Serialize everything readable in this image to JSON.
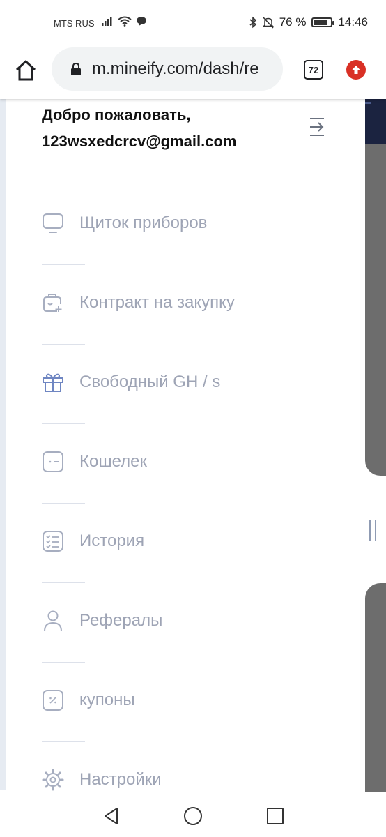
{
  "status_bar": {
    "carrier": "MTS RUS",
    "battery_percent": "76 %",
    "battery_level": 0.76,
    "time": "14:46",
    "icons": [
      "signal-icon",
      "wifi-icon",
      "message-icon",
      "bluetooth-icon",
      "mute-icon",
      "battery-icon"
    ]
  },
  "browser": {
    "url": "m.mineify.com/dash/re",
    "tabs_count": "72",
    "icons": [
      "home-icon",
      "lock-icon",
      "tabs-icon",
      "update-icon"
    ]
  },
  "drawer": {
    "welcome_line1": "Добро пожаловать,",
    "welcome_line2": "123wsxedcrcv@gmail.com",
    "collapse_icon": "collapse-icon",
    "items": [
      {
        "label": "Щиток приборов",
        "icon": "monitor-icon",
        "active": false
      },
      {
        "label": "Контракт на закупку",
        "icon": "contract-icon",
        "active": false
      },
      {
        "label": "Свободный GH / s",
        "icon": "gift-icon",
        "active": true
      },
      {
        "label": "Кошелек",
        "icon": "wallet-icon",
        "active": false
      },
      {
        "label": "История",
        "icon": "history-icon",
        "active": false
      },
      {
        "label": "Рефералы",
        "icon": "user-icon",
        "active": false
      },
      {
        "label": "купоны",
        "icon": "coupon-icon",
        "active": false
      },
      {
        "label": "Настройки",
        "icon": "settings-icon",
        "active": false
      }
    ]
  },
  "colors": {
    "menu_text": "#9ea4b5",
    "menu_icon": "#a7aec0",
    "active_icon": "#6f86c2",
    "dark_header": "#1b2340",
    "overlay_gray": "#6d6d6d"
  },
  "nav_bar": {
    "icons": [
      "back-icon",
      "home-circle-icon",
      "recents-icon"
    ]
  }
}
